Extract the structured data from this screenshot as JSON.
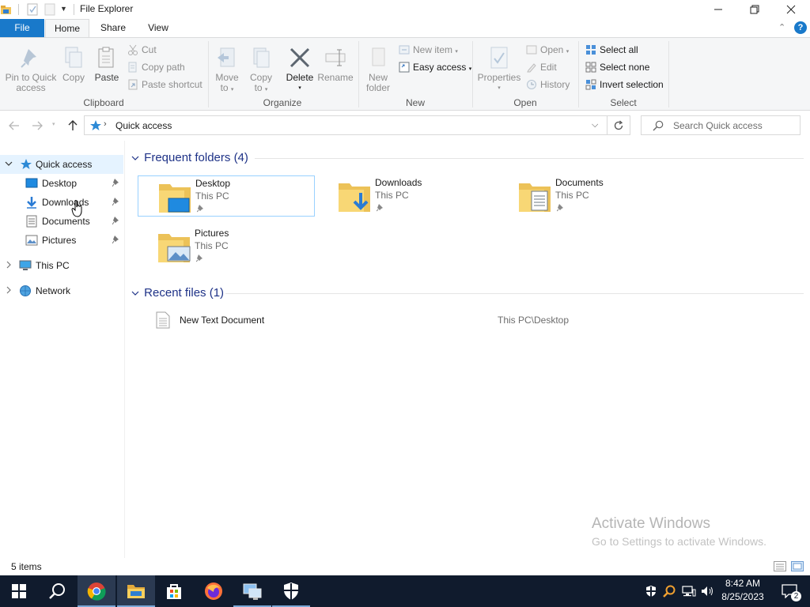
{
  "window": {
    "title": "File Explorer"
  },
  "ribbon": {
    "tabs": [
      {
        "label": "File"
      },
      {
        "label": "Home"
      },
      {
        "label": "Share"
      },
      {
        "label": "View"
      }
    ],
    "clipboard": {
      "pin_label": "Pin to Quick\naccess",
      "pin_l1": "Pin to Quick",
      "pin_l2": "access",
      "copy": "Copy",
      "paste": "Paste",
      "cut": "Cut",
      "copy_path": "Copy path",
      "paste_shortcut": "Paste shortcut",
      "group": "Clipboard"
    },
    "organize": {
      "move_l1": "Move",
      "move_l2": "to",
      "copy_l1": "Copy",
      "copy_l2": "to",
      "delete": "Delete",
      "rename": "Rename",
      "group": "Organize"
    },
    "new": {
      "new_folder_l1": "New",
      "new_folder_l2": "folder",
      "new_item": "New item",
      "easy_access": "Easy access",
      "group": "New"
    },
    "open": {
      "properties": "Properties",
      "open": "Open",
      "edit": "Edit",
      "history": "History",
      "group": "Open"
    },
    "select": {
      "select_all": "Select all",
      "select_none": "Select none",
      "invert": "Invert selection",
      "group": "Select"
    }
  },
  "address": {
    "crumb": "Quick access",
    "search_placeholder": "Search Quick access"
  },
  "nav_pane": {
    "items": [
      {
        "label": "Quick access"
      },
      {
        "label": "Desktop"
      },
      {
        "label": "Downloads"
      },
      {
        "label": "Documents"
      },
      {
        "label": "Pictures"
      },
      {
        "label": "This PC"
      },
      {
        "label": "Network"
      }
    ]
  },
  "content": {
    "frequent_header": "Frequent folders (4)",
    "folders": [
      {
        "name": "Desktop",
        "location": "This PC"
      },
      {
        "name": "Downloads",
        "location": "This PC"
      },
      {
        "name": "Documents",
        "location": "This PC"
      },
      {
        "name": "Pictures",
        "location": "This PC"
      }
    ],
    "recent_header": "Recent files (1)",
    "recent_files": [
      {
        "name": "New Text Document",
        "path": "This PC\\Desktop"
      }
    ]
  },
  "watermark": {
    "line1": "Activate Windows",
    "line2": "Go to Settings to activate Windows."
  },
  "status": {
    "item_count": "5 items"
  },
  "taskbar": {
    "time": "8:42 AM",
    "date": "8/25/2023",
    "notification_count": "2"
  },
  "colors": {
    "accent": "#1979ca",
    "taskbar": "#101b2d",
    "section_header": "#1e3287",
    "selection_border": "#99d1ff"
  }
}
